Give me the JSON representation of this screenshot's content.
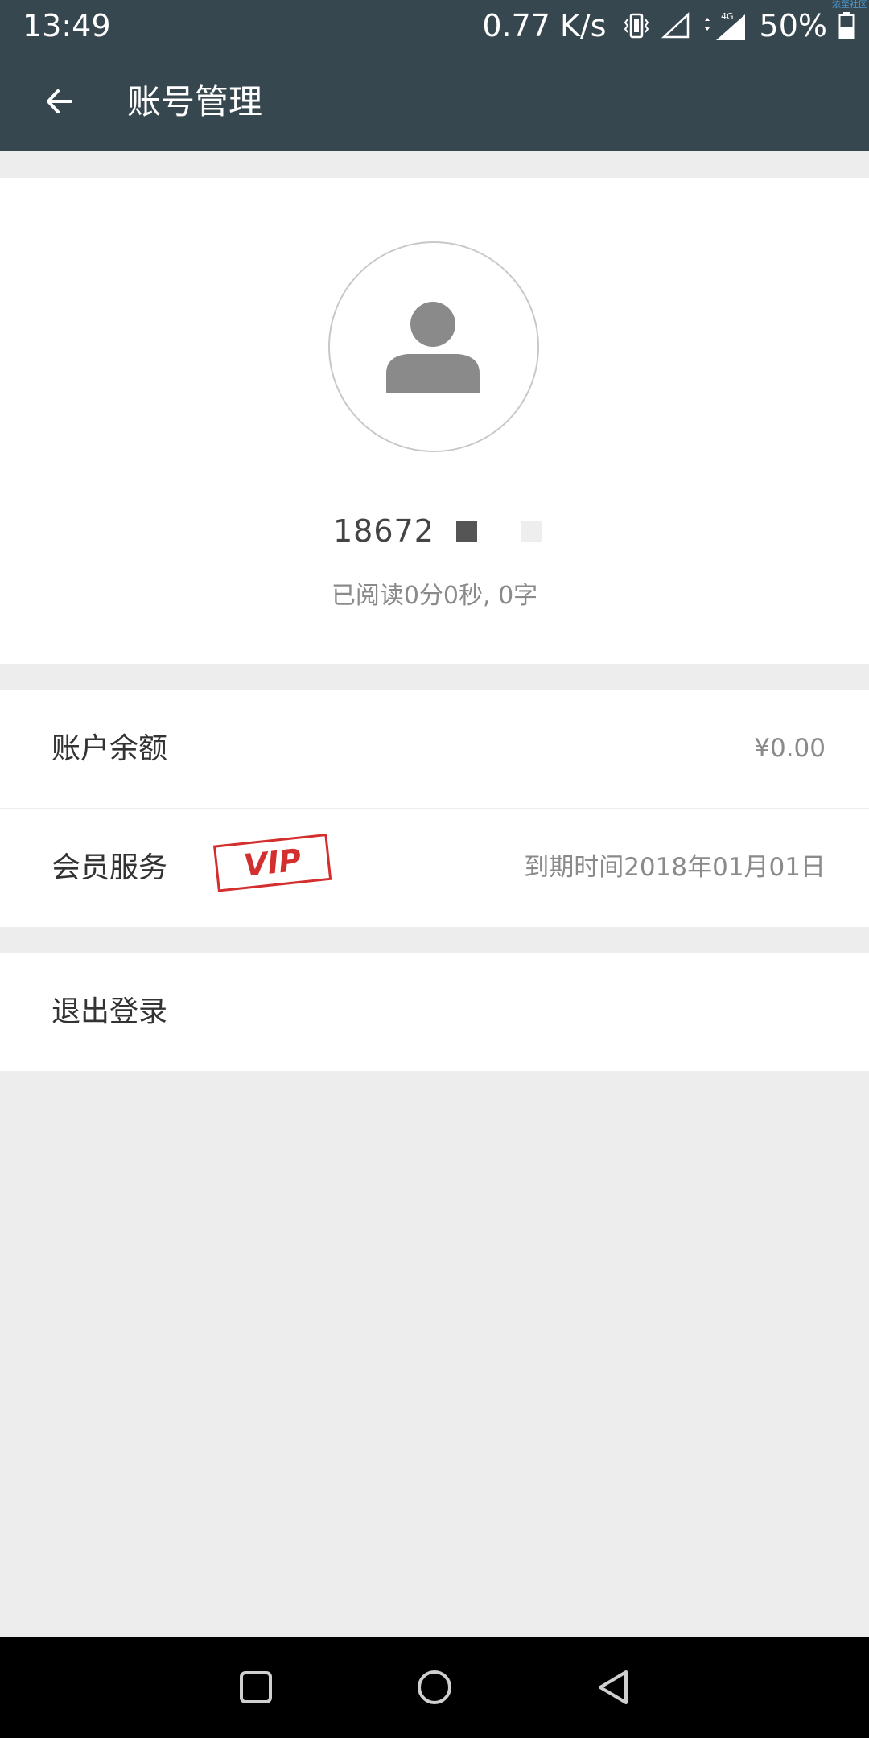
{
  "status_bar": {
    "time": "13:49",
    "network_speed": "0.77 K/s",
    "network_type": "4G",
    "battery": "50%",
    "corner_watermark": "浓至社区",
    "icons": [
      "vibrate-icon",
      "signal-empty-icon",
      "data-arrows-icon",
      "signal-4g-icon",
      "battery-icon"
    ]
  },
  "app_bar": {
    "title": "账号管理",
    "back_icon": "arrow-left-icon"
  },
  "profile": {
    "avatar_icon": "person-icon",
    "phone": "18672",
    "reading_stats": "已阅读0分0秒, 0字"
  },
  "account": {
    "balance_label": "账户余额",
    "balance_value": "¥0.00",
    "membership_label": "会员服务",
    "vip_badge": "VIP",
    "membership_expiry": "到期时间2018年01月01日",
    "logout_label": "退出登录"
  },
  "nav_bar": {
    "icons": [
      "recent-apps-icon",
      "home-icon",
      "back-triangle-icon"
    ]
  },
  "colors": {
    "app_bar": "#37474f",
    "background": "#ededed",
    "card": "#ffffff",
    "vip_red": "#d32f2f",
    "nav_bar": "#000000"
  }
}
